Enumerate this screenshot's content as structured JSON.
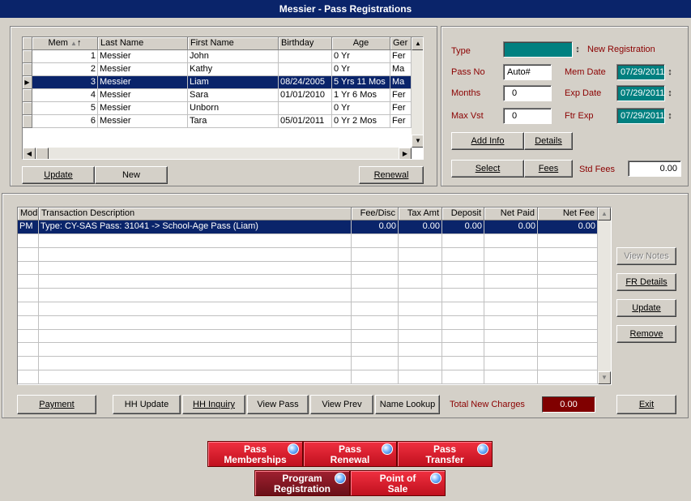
{
  "window": {
    "title": "Messier - Pass Registrations"
  },
  "members_grid": {
    "columns": [
      "Mem",
      "Last Name",
      "First Name",
      "Birthday",
      "Age",
      "Ger"
    ],
    "rows": [
      {
        "mem": "1",
        "last": "Messier",
        "first": "John",
        "birthday": "",
        "age": "0 Yr",
        "gender": "Fer"
      },
      {
        "mem": "2",
        "last": "Messier",
        "first": "Kathy",
        "birthday": "",
        "age": "0 Yr",
        "gender": "Ma"
      },
      {
        "mem": "3",
        "last": "Messier",
        "first": "Liam",
        "birthday": "08/24/2005",
        "age": "5 Yrs 11 Mos",
        "gender": "Ma"
      },
      {
        "mem": "4",
        "last": "Messier",
        "first": "Sara",
        "birthday": "01/01/2010",
        "age": "1 Yr 6 Mos",
        "gender": "Fer"
      },
      {
        "mem": "5",
        "last": "Messier",
        "first": "Unborn",
        "birthday": "",
        "age": "0 Yr",
        "gender": "Fer"
      },
      {
        "mem": "6",
        "last": "Messier",
        "first": "Tara",
        "birthday": "05/01/2011",
        "age": "0 Yr 2 Mos",
        "gender": "Fer"
      }
    ],
    "selected_row": 2
  },
  "member_buttons": {
    "update": "Update",
    "new": "New",
    "renewal": "Renewal"
  },
  "pass_form": {
    "type_label": "Type",
    "type_value": "",
    "registration_status": "New Registration",
    "pass_no_label": "Pass No",
    "pass_no_value": "Auto#",
    "months_label": "Months",
    "months_value": "0",
    "max_vst_label": "Max Vst",
    "max_vst_value": "0",
    "mem_date_label": "Mem Date",
    "mem_date_value": "07/29/2011",
    "exp_date_label": "Exp Date",
    "exp_date_value": "07/29/2011",
    "ftr_exp_label": "Ftr Exp",
    "ftr_exp_value": "07/29/2011",
    "add_info": "Add Info",
    "details": "Details",
    "select": "Select",
    "fees": "Fees",
    "std_fees_label": "Std Fees",
    "std_fees_value": "0.00"
  },
  "transactions_grid": {
    "columns": [
      "Mod",
      "Transaction Description",
      "Fee/Disc",
      "Tax Amt",
      "Deposit",
      "Net Paid",
      "Net Fee"
    ],
    "rows": [
      {
        "mod": "PM",
        "description": "Type: CY-SAS Pass: 31041 -> School-Age Pass (Liam)",
        "fee_disc": "0.00",
        "tax_amt": "0.00",
        "deposit": "0.00",
        "net_paid": "0.00",
        "net_fee": "0.00"
      }
    ]
  },
  "side_buttons": {
    "view_notes": "View Notes",
    "fr_details": "FR Details",
    "update": "Update",
    "remove": "Remove"
  },
  "bottom_bar": {
    "payment": "Payment",
    "hh_update": "HH Update",
    "hh_inquiry": "HH Inquiry",
    "view_pass": "View Pass",
    "view_prev": "View Prev",
    "name_lookup": "Name Lookup",
    "total_label": "Total New Charges",
    "total_value": "0.00",
    "exit": "Exit"
  },
  "nav_buttons": {
    "pass_memberships": [
      "Pass",
      "Memberships"
    ],
    "pass_renewal": [
      "Pass",
      "Renewal"
    ],
    "pass_transfer": [
      "Pass",
      "Transfer"
    ],
    "program_registration": [
      "Program",
      "Registration"
    ],
    "point_of_sale": [
      "Point of",
      "Sale"
    ]
  },
  "colors": {
    "title_bar": "#0a246a",
    "selection": "#0a246a",
    "date_field": "#008080",
    "total_box": "#800000",
    "nav_red": "#e0202e"
  }
}
